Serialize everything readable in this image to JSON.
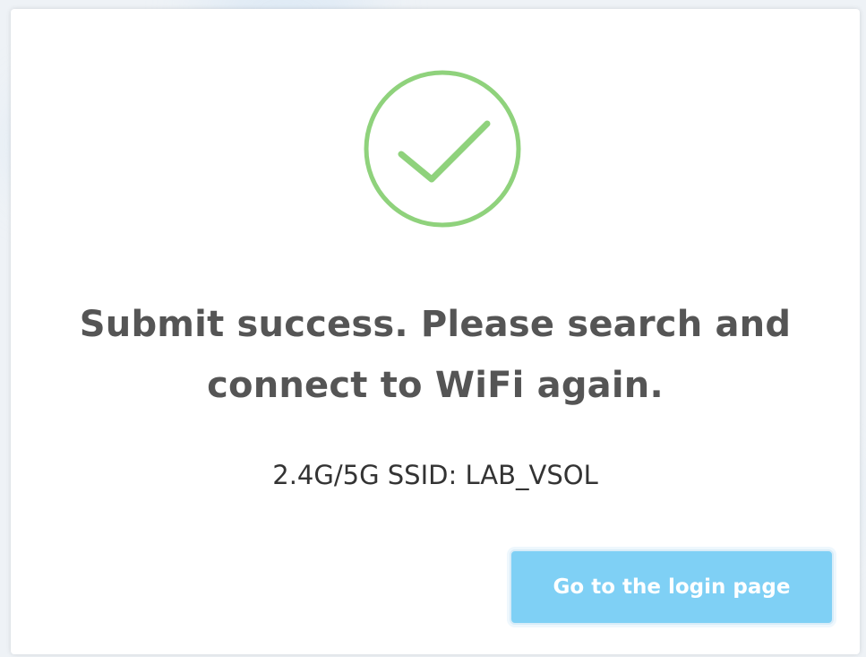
{
  "colors": {
    "success_green": "#8fd27c",
    "button_bg": "#7fd0f5",
    "message_text": "#555555",
    "ssid_text": "#333333"
  },
  "dialog": {
    "icon": "check-circle-icon",
    "message": "Submit success. Please search and connect to WiFi again.",
    "ssid_label": "2.4G/5G SSID: LAB_VSOL",
    "login_button_label": "Go to the login page"
  }
}
